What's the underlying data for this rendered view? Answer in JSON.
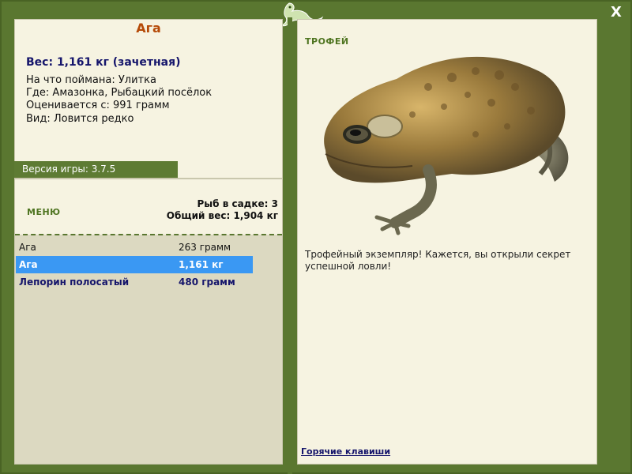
{
  "window": {
    "close_label": "X"
  },
  "fish": {
    "name": "Ага",
    "weight_line": "Вес: 1,161 кг (зачетная)",
    "caught_on": "На что поймана: Улитка",
    "location": "Где: Амазонка, Рыбацкий посёлок",
    "counted_from": "Оценивается с: 991 грамм",
    "rarity": "Вид: Ловится редко"
  },
  "version": "Версия игры: 3.7.5",
  "menu_label": "МЕНЮ",
  "keep": {
    "count_line": "Рыб в садке: 3",
    "total_line": "Общий вес: 1,904 кг"
  },
  "catches": [
    {
      "name": "Ага",
      "weight": "263 грамм"
    },
    {
      "name": "Ага",
      "weight": "1,161 кг"
    },
    {
      "name": "Лепорин полосатый",
      "weight": "480 грамм"
    }
  ],
  "trophy": {
    "label": "ТРОФЕЙ",
    "description": "Трофейный экземпляр! Кажется, вы открыли секрет успешной ловли!",
    "hotkeys_link": "Горячие клавиши"
  },
  "colors": {
    "frame_green": "#5a7730",
    "panel_cream": "#f6f3e1",
    "list_bg": "#dcd9c1",
    "selected_blue": "#3a98f3",
    "fish_name_orange": "#b54a08",
    "navy_text": "#15156b"
  },
  "icons": [
    "lizard-logo-icon",
    "close-icon",
    "toad-image"
  ]
}
